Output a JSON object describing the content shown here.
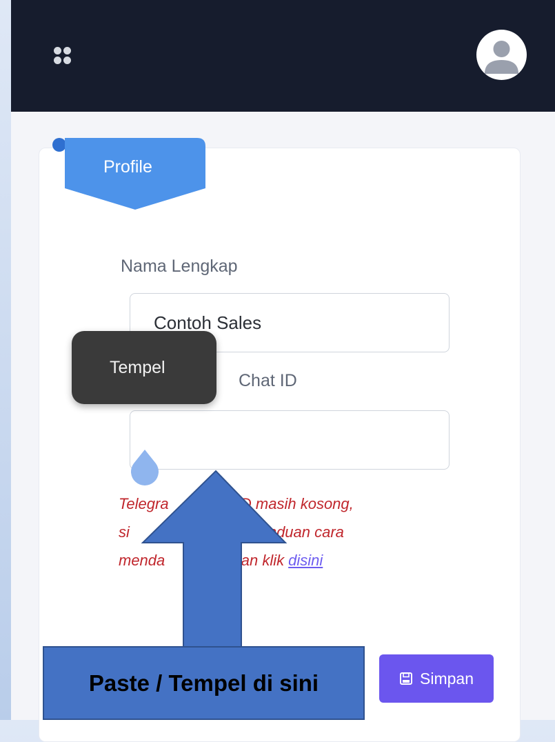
{
  "header": {
    "menu_icon": "grid-menu-icon",
    "avatar_icon": "user-avatar-icon"
  },
  "profile_tab": {
    "label": "Profile"
  },
  "form": {
    "name_label": "Nama Lengkap",
    "name_value": "Contoh Sales",
    "chat_label": "Chat ID",
    "chat_value": "",
    "error_lines": [
      "Telegra",
      "t ID masih kosong,",
      "si",
      "lihat panduan cara",
      "menda",
      "ngan klik"
    ],
    "error_link": "disini"
  },
  "context_menu": {
    "paste_label": "Tempel"
  },
  "actions": {
    "save_label": "Simpan",
    "save_icon": "floppy-disk-icon"
  },
  "annotation": {
    "callout_text": "Paste / Tempel di sini"
  },
  "colors": {
    "header_bg": "#161c2d",
    "ribbon": "#4d93ea",
    "save_bg": "#6b56ee",
    "error": "#c0262c",
    "callout_bg": "#4472c4"
  }
}
